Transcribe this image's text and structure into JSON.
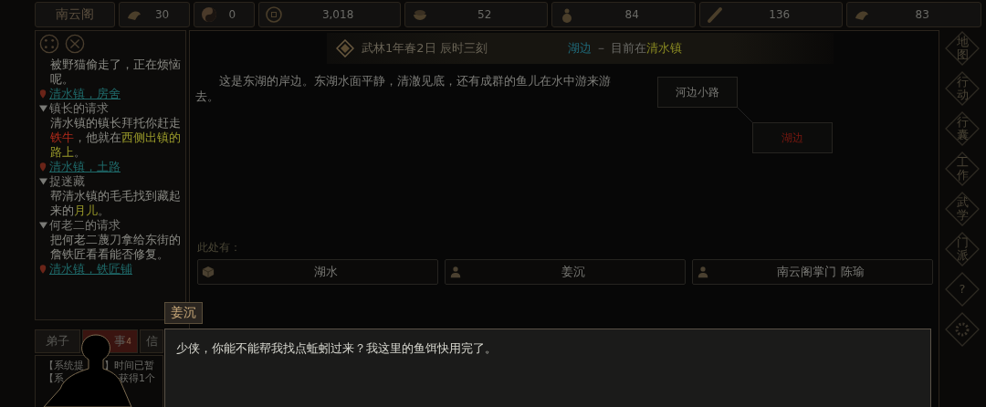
{
  "top_bar": {
    "faction": "南云阁",
    "stats": [
      {
        "value": "30"
      },
      {
        "value": "0"
      },
      {
        "value": "3,018"
      },
      {
        "value": "52"
      },
      {
        "value": "84"
      },
      {
        "value": "136"
      },
      {
        "value": "83"
      }
    ]
  },
  "quest_panel": {
    "items": [
      {
        "kind": "tail",
        "segments": [
          {
            "kind": "plain",
            "text": "被野猫偷走了，正在烦恼呢。"
          }
        ],
        "location": "清水镇，房舍"
      },
      {
        "kind": "quest",
        "title": "镇长的请求",
        "segments": [
          {
            "kind": "plain",
            "text": "清水镇的镇长拜托你赶走"
          },
          {
            "kind": "enemy",
            "text": "铁牛"
          },
          {
            "kind": "plain",
            "text": "，他就在"
          },
          {
            "kind": "place",
            "text": "西侧出镇的路上"
          },
          {
            "kind": "plain",
            "text": "。"
          }
        ],
        "location": "清水镇，土路"
      },
      {
        "kind": "quest",
        "title": "捉迷藏",
        "segments": [
          {
            "kind": "plain",
            "text": "帮清水镇的毛毛找到藏起来的"
          },
          {
            "kind": "place",
            "text": "月儿"
          },
          {
            "kind": "plain",
            "text": "。"
          }
        ]
      },
      {
        "kind": "quest",
        "title": "何老二的请求",
        "segments": [
          {
            "kind": "plain",
            "text": "把何老二蔑刀拿给东街的詹铁匠看看能否修复。"
          }
        ],
        "location": "清水镇，铁匠铺"
      }
    ]
  },
  "bottom_tabs": [
    {
      "label": "弟子",
      "selected": false
    },
    {
      "label": "事",
      "selected": true,
      "badge": "4"
    },
    {
      "label": "信",
      "selected": false
    }
  ],
  "log": [
    {
      "left": "【系统提",
      "right": "】时间已暂"
    },
    {
      "left": "【系",
      "right": "获得1个"
    }
  ],
  "header": {
    "date": "武林1年春2日 辰时三刻",
    "place": "湖边",
    "separator": "－",
    "current_prefix": "目前在",
    "town": "清水镇"
  },
  "description": "这是东湖的岸边。东湖水面平静，清澈见底，还有成群的鱼儿在水中游来游去。",
  "map": {
    "nodes": [
      {
        "label": "河边小路",
        "selected": false
      },
      {
        "label": "湖边",
        "selected": true
      }
    ]
  },
  "here": {
    "label": "此处有：",
    "objects": [
      {
        "kind": "item",
        "label": "湖水"
      },
      {
        "kind": "person",
        "label": "姜沉"
      },
      {
        "kind": "person",
        "label": "南云阁掌门 陈瑜"
      }
    ]
  },
  "side_menu": [
    {
      "kind": "text",
      "label": "地图"
    },
    {
      "kind": "text",
      "label": "行动"
    },
    {
      "kind": "text",
      "label": "行囊"
    },
    {
      "kind": "text",
      "label": "工作"
    },
    {
      "kind": "text",
      "label": "武学"
    },
    {
      "kind": "text",
      "label": "门派"
    },
    {
      "kind": "text",
      "label": "?"
    },
    {
      "kind": "gear"
    }
  ],
  "dialog": {
    "speaker": "姜沉",
    "text": "少侠，你能不能帮我找点蚯蚓过来？我这里的鱼饵快用完了。"
  }
}
